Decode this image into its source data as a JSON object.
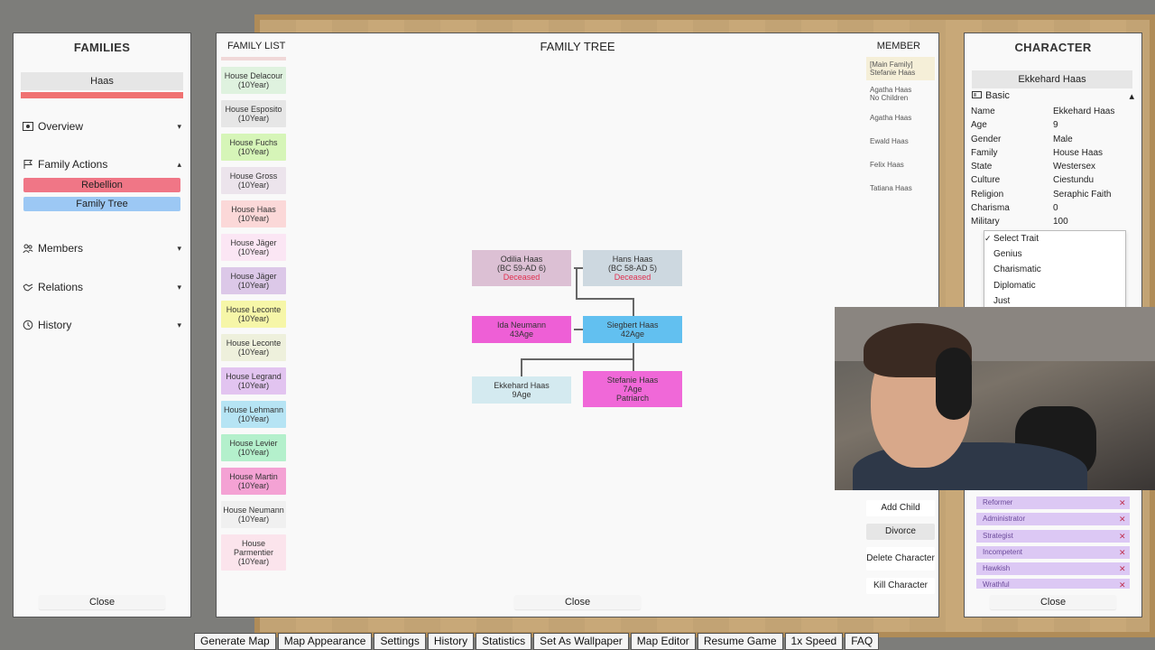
{
  "families_panel": {
    "title": "FAMILIES",
    "selected_family": "Haas",
    "family_color": "#f07272",
    "sections": {
      "overview": "Overview",
      "family_actions": "Family Actions",
      "members": "Members",
      "relations": "Relations",
      "history": "History"
    },
    "actions": {
      "rebellion": "Rebellion",
      "family_tree": "Family Tree"
    },
    "close": "Close"
  },
  "main_panel": {
    "family_list_header": "FAMILY LIST",
    "title": "FAMILY TREE",
    "member_header": "MEMBER",
    "houses": [
      {
        "name": "House Delacour",
        "years": "(10Year)",
        "color": "#dff2df"
      },
      {
        "name": "House Esposito",
        "years": "(10Year)",
        "color": "#e6e6e6"
      },
      {
        "name": "House Fuchs",
        "years": "(10Year)",
        "color": "#d6f5b8"
      },
      {
        "name": "House Gross",
        "years": "(10Year)",
        "color": "#ece4ec"
      },
      {
        "name": "House Haas",
        "years": "(10Year)",
        "color": "#fbd8d8"
      },
      {
        "name": "House Jäger",
        "years": "(10Year)",
        "color": "#fbe6f4"
      },
      {
        "name": "House Jäger",
        "years": "(10Year)",
        "color": "#dcc8e8"
      },
      {
        "name": "House Leconte",
        "years": "(10Year)",
        "color": "#f6f6a8"
      },
      {
        "name": "House Leconte",
        "years": "(10Year)",
        "color": "#eef0dc"
      },
      {
        "name": "House Legrand",
        "years": "(10Year)",
        "color": "#e2c4f0"
      },
      {
        "name": "House Lehmann",
        "years": "(10Year)",
        "color": "#b6e4f4"
      },
      {
        "name": "House Levier",
        "years": "(10Year)",
        "color": "#b4f0cc"
      },
      {
        "name": "House Martin",
        "years": "(10Year)",
        "color": "#f4a2d4"
      },
      {
        "name": "House Neumann",
        "years": "(10Year)",
        "color": "#f0f0f0"
      },
      {
        "name": "House Parmentier",
        "years": "(10Year)",
        "color": "#fbe4ec"
      }
    ],
    "tree": {
      "odilia": {
        "name": "Odilia Haas",
        "line2": "(BC 59-AD 6)",
        "line3": "Deceased",
        "color": "#dcc0d4"
      },
      "hans": {
        "name": "Hans Haas",
        "line2": "(BC 58-AD 5)",
        "line3": "Deceased",
        "color": "#cdd8e0"
      },
      "ida": {
        "name": "Ida Neumann",
        "line2": "43Age",
        "color": "#ee5fd6"
      },
      "siegbert": {
        "name": "Siegbert Haas",
        "line2": "42Age",
        "color": "#62c0f0"
      },
      "ekkehard": {
        "name": "Ekkehard Haas",
        "line2": "9Age",
        "color": "#d4eaf0"
      },
      "stefanie": {
        "name": "Stefanie Haas",
        "line2": "7Age",
        "line3": "Patriarch",
        "color": "#f068d8"
      }
    },
    "members": [
      {
        "line1": "[Main Family]",
        "line2": "Stefanie Haas"
      },
      {
        "line1": "Agatha Haas",
        "line2": "No Children"
      },
      {
        "line1": "Agatha Haas",
        "line2": ""
      },
      {
        "line1": "Ewald Haas",
        "line2": ""
      },
      {
        "line1": "Felix Haas",
        "line2": ""
      },
      {
        "line1": "Tatiana Haas",
        "line2": ""
      }
    ],
    "buttons": {
      "add_child": "Add Child",
      "divorce": "Divorce",
      "delete_character": "Delete Character",
      "kill_character": "Kill Character"
    },
    "close": "Close"
  },
  "character_panel": {
    "title": "CHARACTER",
    "name_display": "Ekkehard Haas",
    "basic_header": "Basic",
    "attributes": [
      {
        "k": "Name",
        "v": "Ekkehard Haas"
      },
      {
        "k": "Age",
        "v": "9"
      },
      {
        "k": "Gender",
        "v": "Male"
      },
      {
        "k": "Family",
        "v": "House Haas"
      },
      {
        "k": "State",
        "v": "Westersex"
      },
      {
        "k": "Culture",
        "v": "Ciestundu"
      },
      {
        "k": "Religion",
        "v": "Seraphic Faith"
      },
      {
        "k": "Charisma",
        "v": "0"
      },
      {
        "k": "Military",
        "v": "100"
      }
    ],
    "trait_dropdown": [
      "Select Trait",
      "Genius",
      "Charismatic",
      "Diplomatic",
      "Just"
    ],
    "traits": [
      "Reformer",
      "Administrator",
      "Strategist",
      "Incompetent",
      "Hawkish",
      "Wrathful"
    ],
    "close": "Close"
  },
  "toolbar": [
    "Generate Map",
    "Map Appearance",
    "Settings",
    "History",
    "Statistics",
    "Set As Wallpaper",
    "Map Editor",
    "Resume Game",
    "1x Speed",
    "FAQ"
  ]
}
